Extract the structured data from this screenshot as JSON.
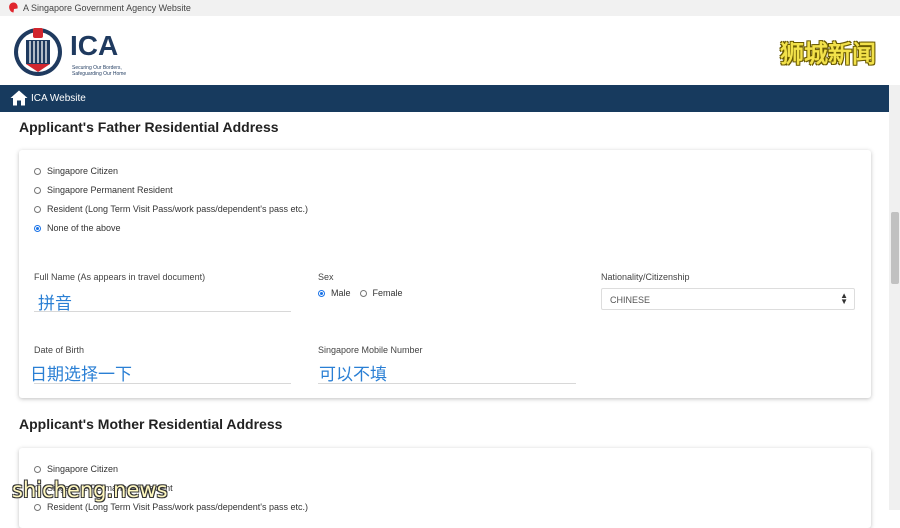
{
  "topbar": {
    "text": "A Singapore Government Agency Website",
    "icon": "lion-head-icon"
  },
  "header": {
    "logo_text": "ICA",
    "tagline_line1": "Securing Our Borders,",
    "tagline_line2": "Safeguarding Our Home",
    "watermark": "狮城新闻"
  },
  "nav": {
    "home_icon": "home-icon",
    "link": "ICA Website"
  },
  "father": {
    "title": "Applicant's Father Residential Address",
    "options": [
      {
        "label": "Singapore Citizen",
        "checked": false
      },
      {
        "label": "Singapore Permanent Resident",
        "checked": false
      },
      {
        "label": "Resident (Long Term Visit Pass/work pass/dependent's pass etc.)",
        "checked": false
      },
      {
        "label": "None of the above",
        "checked": true
      }
    ],
    "full_name_label": "Full Name (As appears in travel document)",
    "full_name_value": "拼音",
    "sex_label": "Sex",
    "sex_male": "Male",
    "sex_female": "Female",
    "sex_selected": "Male",
    "nationality_label": "Nationality/Citizenship",
    "nationality_value": "CHINESE",
    "dob_label": "Date of Birth",
    "dob_value": "日期选择一下",
    "mobile_label": "Singapore Mobile Number",
    "mobile_value": "可以不填"
  },
  "mother": {
    "title": "Applicant's Mother Residential Address",
    "options": [
      {
        "label": "Singapore Citizen",
        "checked": false
      },
      {
        "label": "Singapore Permanent Resident",
        "checked": false
      },
      {
        "label": "Resident (Long Term Visit Pass/work pass/dependent's pass etc.)",
        "checked": false
      }
    ]
  },
  "watermark_bottom": "shicheng.news",
  "colors": {
    "navbar": "#173a5e",
    "accent": "#1a73e8",
    "handwriting": "#2a7fd4"
  }
}
